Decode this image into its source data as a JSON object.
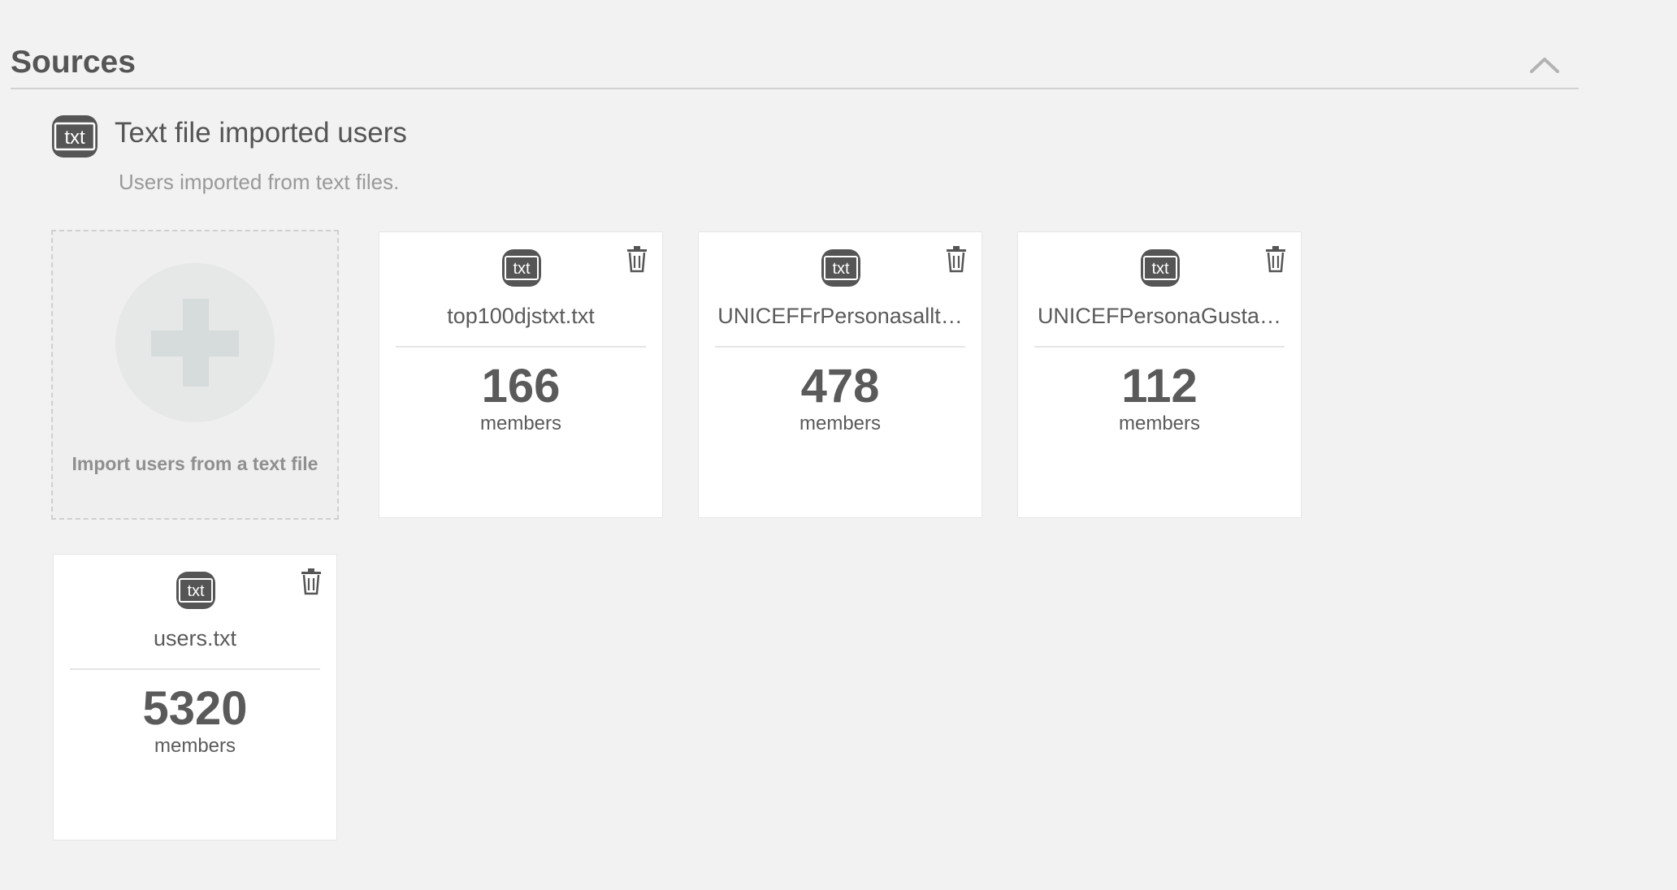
{
  "section": {
    "title": "Sources",
    "collapse_icon": "chevron-up-icon"
  },
  "source": {
    "icon": "txt-file-icon",
    "icon_text": "txt",
    "title": "Text file imported users",
    "description": "Users imported from text files."
  },
  "import_card": {
    "icon": "plus-icon",
    "label": "Import users from a text file"
  },
  "cards": [
    {
      "icon_text": "txt",
      "name": "top100djstxt.txt",
      "count": "166",
      "unit": "members"
    },
    {
      "icon_text": "txt",
      "name": "UNICEFFrPersonasallt…",
      "count": "478",
      "unit": "members"
    },
    {
      "icon_text": "txt",
      "name": "UNICEFPersonaGusta…",
      "count": "112",
      "unit": "members"
    },
    {
      "icon_text": "txt",
      "name": "users.txt",
      "count": "5320",
      "unit": "members"
    }
  ],
  "colors": {
    "background": "#f2f2f2",
    "card": "#ffffff",
    "text": "#5a5a5a",
    "muted": "#999999",
    "icon": "#555555"
  }
}
